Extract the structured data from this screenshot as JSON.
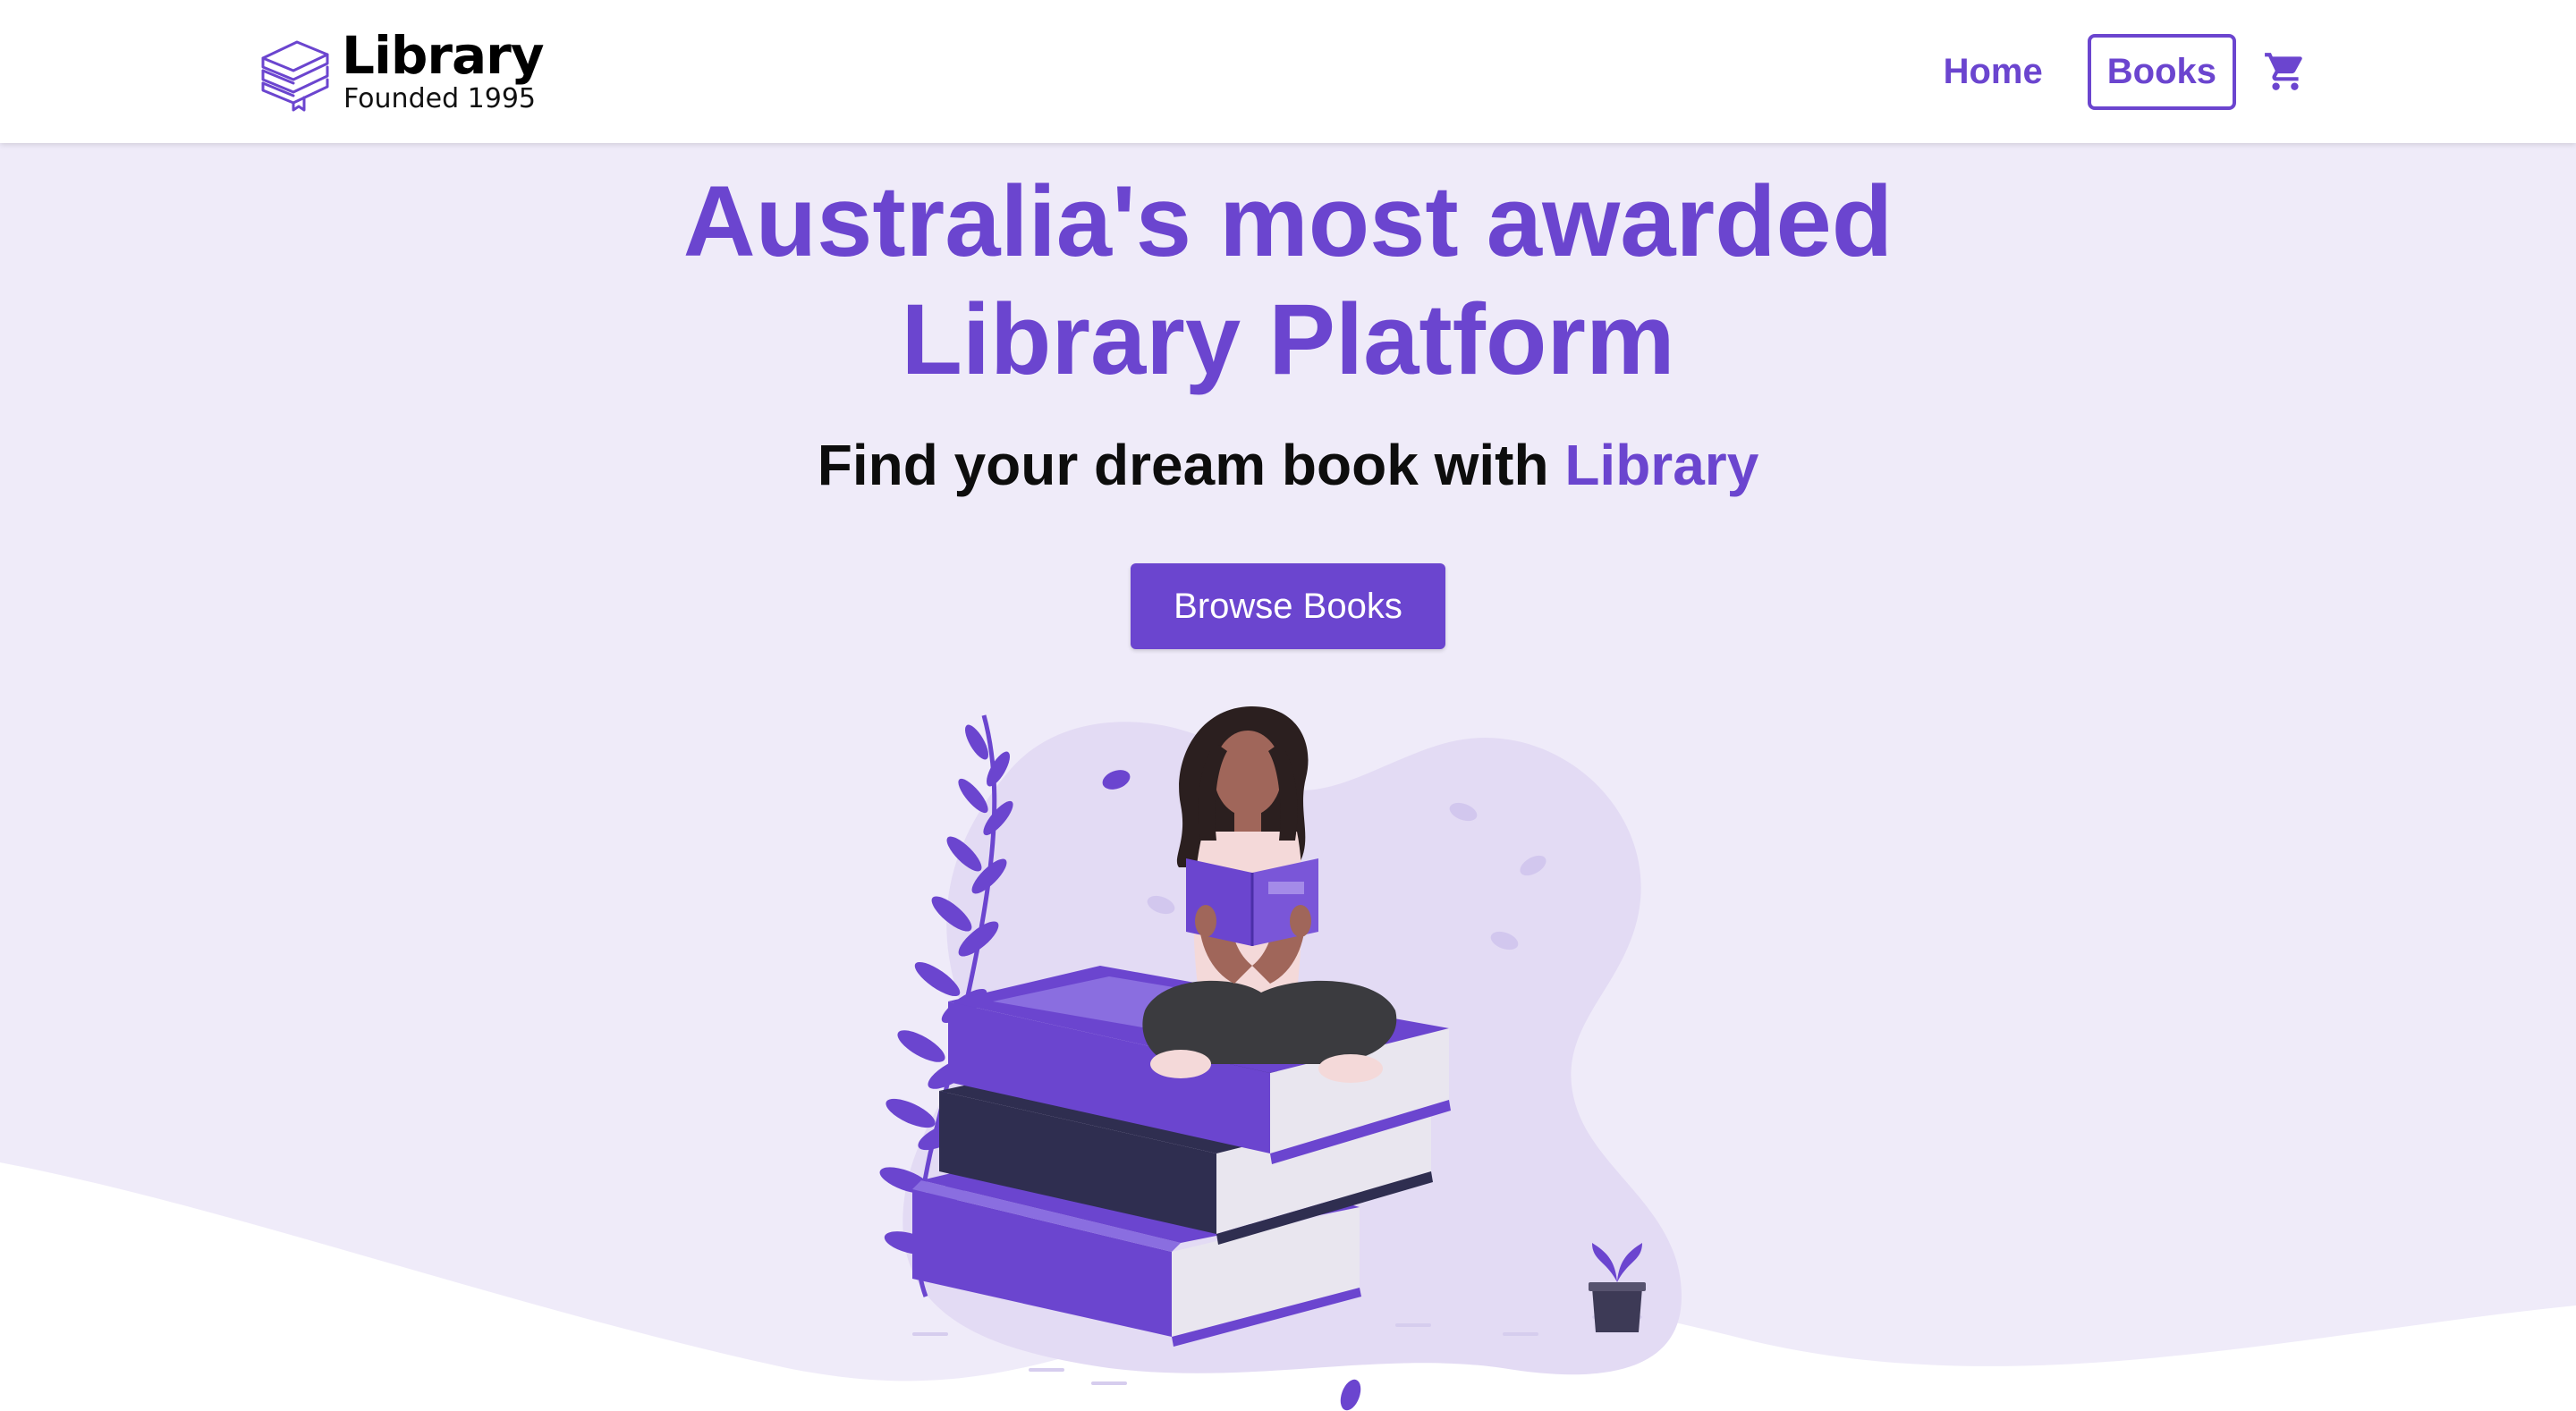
{
  "brand": {
    "name": "Library",
    "tagline": "Founded 1995"
  },
  "nav": {
    "home": "Home",
    "books": "Books",
    "active": "Books"
  },
  "hero": {
    "title_line1": "Australia's most awarded",
    "title_line2": "Library Platform",
    "subtitle_prefix": "Find your dream book with ",
    "subtitle_accent": "Library",
    "cta": "Browse Books"
  },
  "icons": {
    "logo": "books-stack-icon",
    "cart": "shopping-cart-icon"
  },
  "colors": {
    "accent": "#6b45cf",
    "hero_background": "#efebf9",
    "blob": "#e3dbf4",
    "dark_book": "#2f2e50",
    "text_dark": "#0d0d0d"
  }
}
